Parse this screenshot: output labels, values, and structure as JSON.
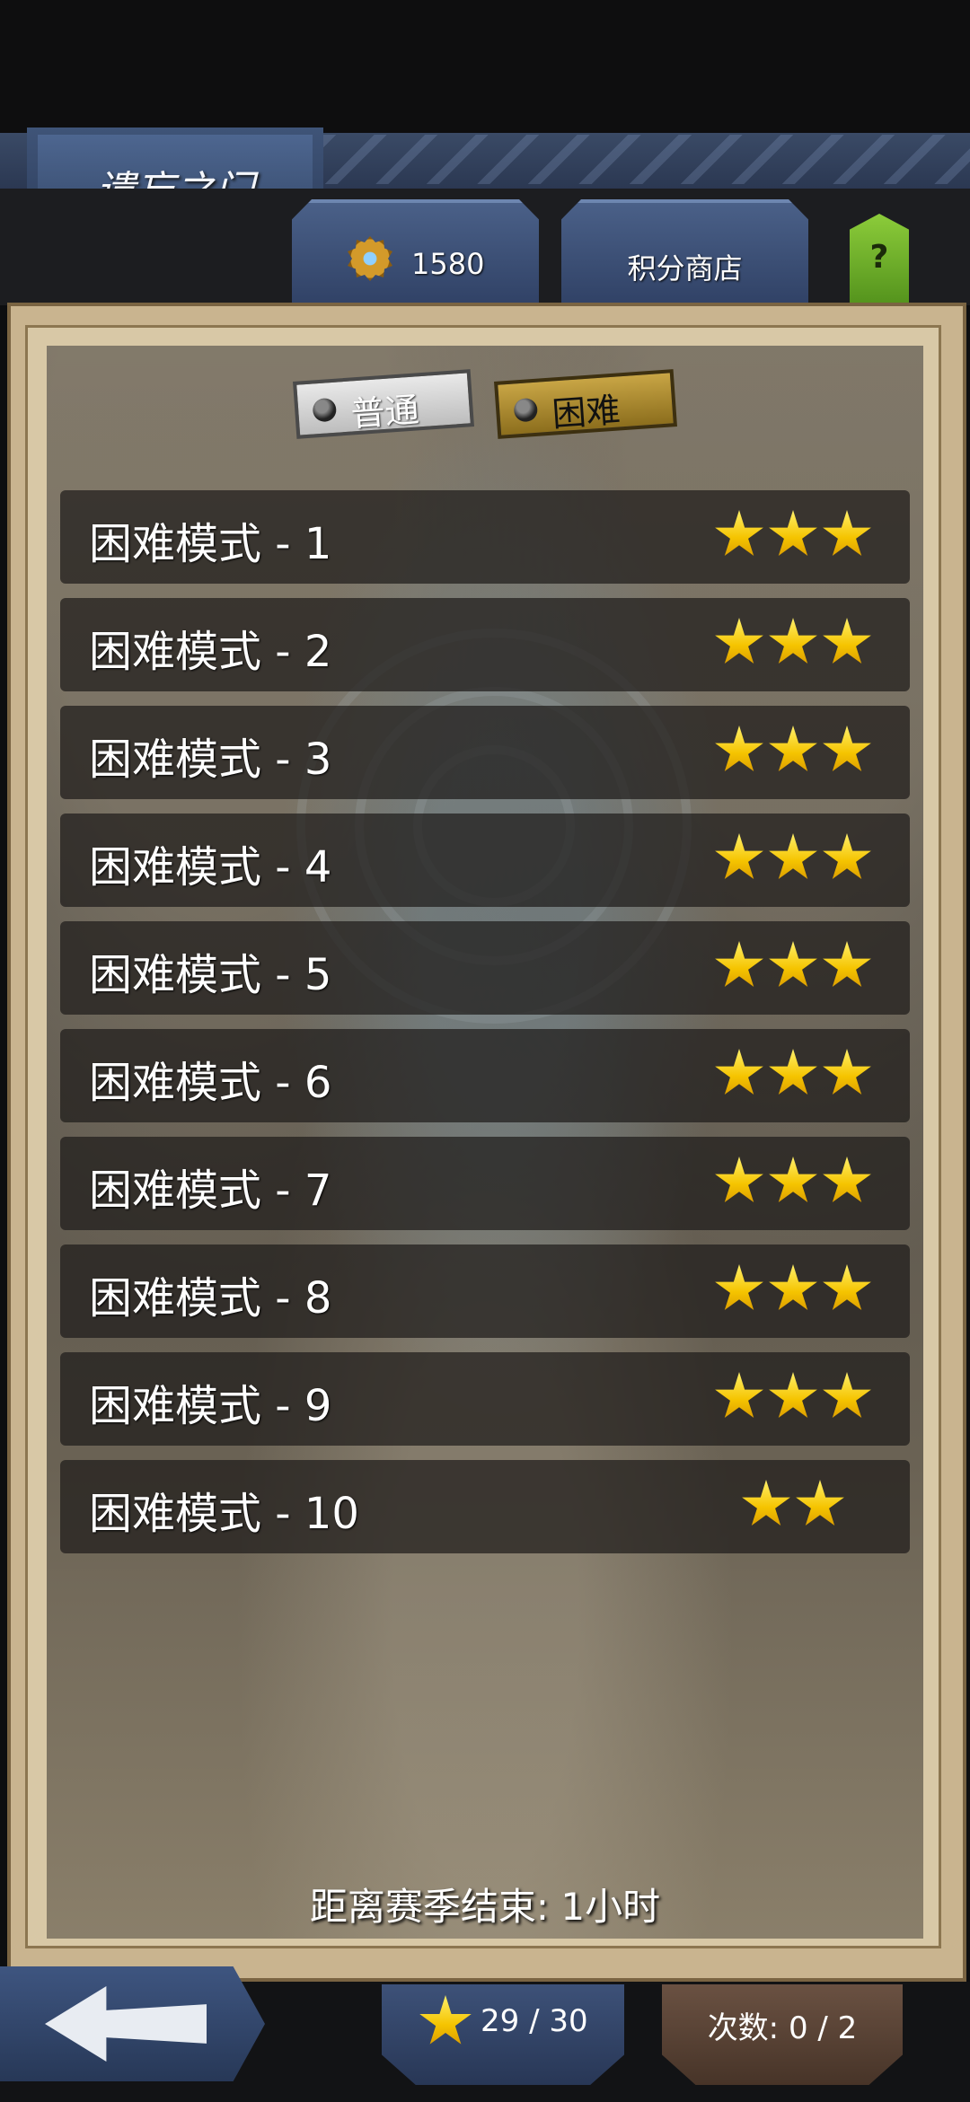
{
  "header": {
    "title": "遗忘之门"
  },
  "top_tabs": {
    "points_value": "1580",
    "shop_label": "积分商店",
    "help_label": "?"
  },
  "mode_toggle": {
    "normal_label": "普通",
    "hard_label": "困难",
    "selected": "困难"
  },
  "levels": [
    {
      "name": "困难模式 - 1",
      "stars": 3
    },
    {
      "name": "困难模式 - 2",
      "stars": 3
    },
    {
      "name": "困难模式 - 3",
      "stars": 3
    },
    {
      "name": "困难模式 - 4",
      "stars": 3
    },
    {
      "name": "困难模式 - 5",
      "stars": 3
    },
    {
      "name": "困难模式 - 6",
      "stars": 3
    },
    {
      "name": "困难模式 - 7",
      "stars": 3
    },
    {
      "name": "困难模式 - 8",
      "stars": 3
    },
    {
      "name": "困难模式 - 9",
      "stars": 3
    },
    {
      "name": "困难模式 - 10",
      "stars": 2
    }
  ],
  "season": {
    "text": "距离赛季结束: 1小时"
  },
  "footer": {
    "stars_total": "29 / 30",
    "attempts": "次数: 0 / 2"
  },
  "colors": {
    "star": "#f5c400",
    "help_button": "#6eb12a",
    "hard_selected": "#b8952f",
    "tab_blue": "#3a4f78",
    "attempts_brown": "#5a4436"
  },
  "icons": {
    "points": "medal-icon",
    "star": "star-icon",
    "back": "back-arrow-icon"
  }
}
